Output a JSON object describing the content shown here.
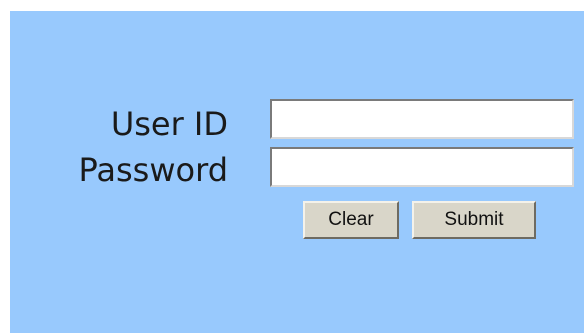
{
  "login_form": {
    "userid_label": "User ID",
    "password_label": "Password",
    "userid_value": "",
    "password_value": "",
    "clear_label": "Clear",
    "submit_label": "Submit"
  },
  "colors": {
    "panel_background": "#98c9fd",
    "button_face": "#d9d6c9"
  }
}
